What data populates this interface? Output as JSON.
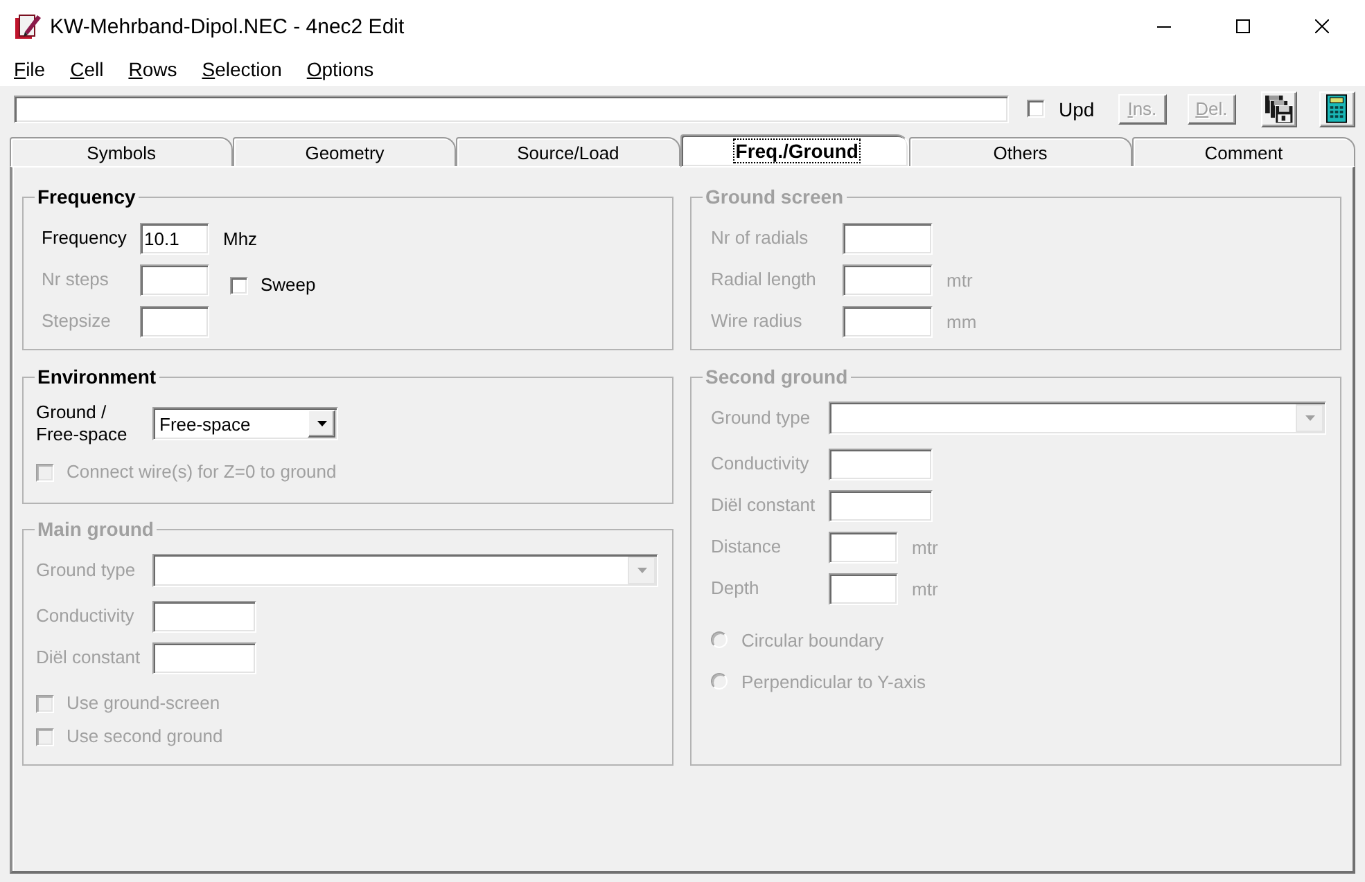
{
  "window": {
    "title": "KW-Mehrband-Dipol.NEC - 4nec2 Edit"
  },
  "menu": [
    {
      "label": "File"
    },
    {
      "label": "Cell"
    },
    {
      "label": "Rows"
    },
    {
      "label": "Selection"
    },
    {
      "label": "Options"
    }
  ],
  "toolbar": {
    "update": {
      "label": "Upd",
      "checked": false
    },
    "buttons": [
      {
        "label": "Ins.",
        "disabled": true
      },
      {
        "label": "Del.",
        "disabled": true
      }
    ]
  },
  "tabs": [
    {
      "label": "Symbols",
      "selected": false
    },
    {
      "label": "Geometry",
      "selected": false
    },
    {
      "label": "Source/Load",
      "selected": false
    },
    {
      "label": "Freq./Ground",
      "selected": true
    },
    {
      "label": "Others",
      "selected": false
    },
    {
      "label": "Comment",
      "selected": false
    }
  ],
  "panel": {
    "left": [
      {
        "title": "Frequency",
        "disabled": false,
        "rows": [
          {
            "kind": "field",
            "label": "Frequency",
            "value": "10.1",
            "unit": "Mhz",
            "disabled": false
          },
          {
            "kind": "field",
            "label": "Nr steps",
            "disabled": true,
            "checkbox": {
              "label": "Sweep",
              "checked": false,
              "disabled": false
            }
          },
          {
            "kind": "field",
            "label": "Stepsize",
            "disabled": true
          }
        ]
      },
      {
        "title": "Environment",
        "disabled": false,
        "rows": [
          {
            "kind": "select",
            "label": "Ground /\nFree-space",
            "value": "Free-space",
            "disabled": false
          },
          {
            "kind": "checkbox",
            "label": "Connect wire(s) for Z=0 to ground",
            "checked": false,
            "disabled": true
          }
        ]
      },
      {
        "title": "Main ground",
        "disabled": true,
        "rows": [
          {
            "kind": "select",
            "label": "Ground type",
            "disabled": true
          },
          {
            "kind": "field",
            "label": "Conductivity",
            "disabled": true
          },
          {
            "kind": "field",
            "label": "Diël constant",
            "disabled": true
          },
          {
            "kind": "checkbox",
            "label": "Use ground-screen",
            "checked": false,
            "disabled": true
          },
          {
            "kind": "checkbox",
            "label": "Use second ground",
            "checked": false,
            "disabled": true
          }
        ]
      }
    ],
    "right": [
      {
        "title": "Ground screen",
        "disabled": true,
        "rows": [
          {
            "kind": "field",
            "label": "Nr of radials",
            "disabled": true
          },
          {
            "kind": "field",
            "label": "Radial length",
            "unit": "mtr",
            "disabled": true
          },
          {
            "kind": "field",
            "label": "Wire radius",
            "unit": "mm",
            "disabled": true
          }
        ]
      },
      {
        "title": "Second ground",
        "disabled": true,
        "rows": [
          {
            "kind": "select",
            "label": "Ground type",
            "disabled": true
          },
          {
            "kind": "field",
            "label": "Conductivity",
            "disabled": true
          },
          {
            "kind": "field",
            "label": "Diël constant",
            "disabled": true
          },
          {
            "kind": "field",
            "label": "Distance",
            "unit": "mtr",
            "disabled": true
          },
          {
            "kind": "field",
            "label": "Depth",
            "unit": "mtr",
            "disabled": true
          },
          {
            "kind": "radio",
            "label": "Circular boundary",
            "selected": false,
            "disabled": true
          },
          {
            "kind": "radio",
            "label": "Perpendicular to Y-axis",
            "selected": false,
            "disabled": true
          }
        ]
      }
    ]
  }
}
